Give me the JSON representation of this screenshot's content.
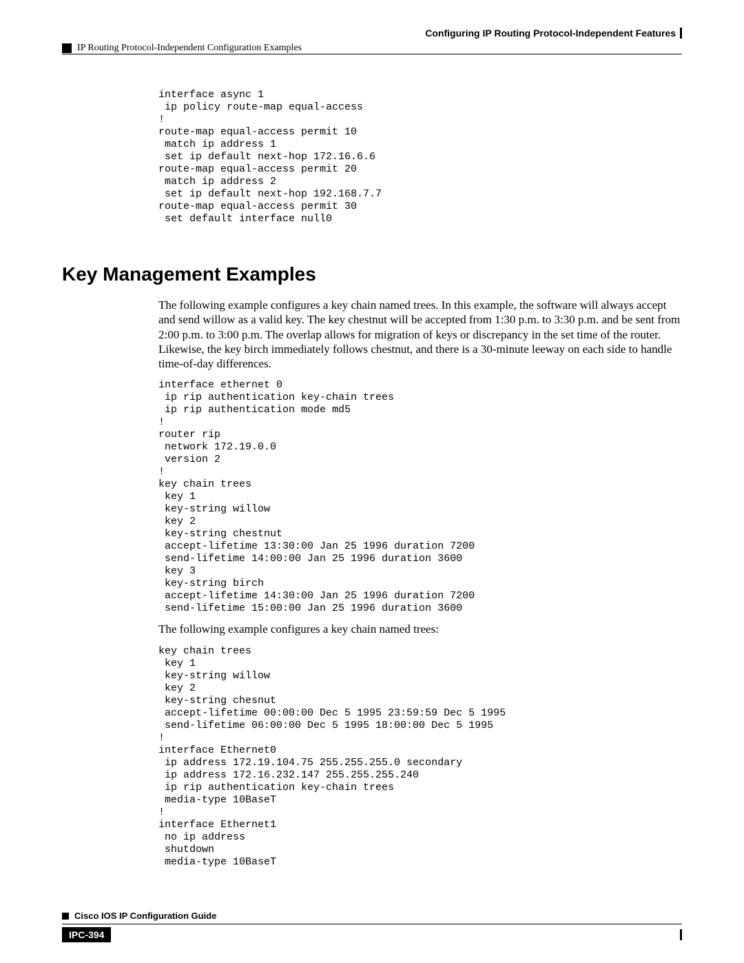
{
  "header": {
    "chapter_title": "Configuring IP Routing Protocol-Independent Features",
    "section_path": "IP Routing Protocol-Independent Configuration Examples"
  },
  "code1": "interface async 1\n ip policy route-map equal-access\n!\nroute-map equal-access permit 10\n match ip address 1\n set ip default next-hop 172.16.6.6\nroute-map equal-access permit 20\n match ip address 2\n set ip default next-hop 192.168.7.7\nroute-map equal-access permit 30\n set default interface null0",
  "heading": "Key Management Examples",
  "para1": "The following example configures a key chain named trees. In this example, the software will always accept and send willow as a valid key. The key chestnut will be accepted from 1:30 p.m. to 3:30 p.m. and be sent from 2:00 p.m. to 3:00 p.m. The overlap allows for migration of keys or discrepancy in the set time of the router. Likewise, the key birch immediately follows chestnut, and there is a 30-minute leeway on each side to handle time-of-day differences.",
  "code2": "interface ethernet 0\n ip rip authentication key-chain trees\n ip rip authentication mode md5\n!\nrouter rip\n network 172.19.0.0\n version 2\n!\nkey chain trees\n key 1\n key-string willow\n key 2\n key-string chestnut\n accept-lifetime 13:30:00 Jan 25 1996 duration 7200\n send-lifetime 14:00:00 Jan 25 1996 duration 3600\n key 3\n key-string birch\n accept-lifetime 14:30:00 Jan 25 1996 duration 7200\n send-lifetime 15:00:00 Jan 25 1996 duration 3600",
  "para2": "The following example configures a key chain named trees:",
  "code3": "key chain trees\n key 1\n key-string willow\n key 2\n key-string chesnut\n accept-lifetime 00:00:00 Dec 5 1995 23:59:59 Dec 5 1995\n send-lifetime 06:00:00 Dec 5 1995 18:00:00 Dec 5 1995\n!\ninterface Ethernet0\n ip address 172.19.104.75 255.255.255.0 secondary\n ip address 172.16.232.147 255.255.255.240\n ip rip authentication key-chain trees\n media-type 10BaseT\n!\ninterface Ethernet1\n no ip address\n shutdown\n media-type 10BaseT",
  "footer": {
    "guide_title": "Cisco IOS IP Configuration Guide",
    "page_number": "IPC-394"
  }
}
